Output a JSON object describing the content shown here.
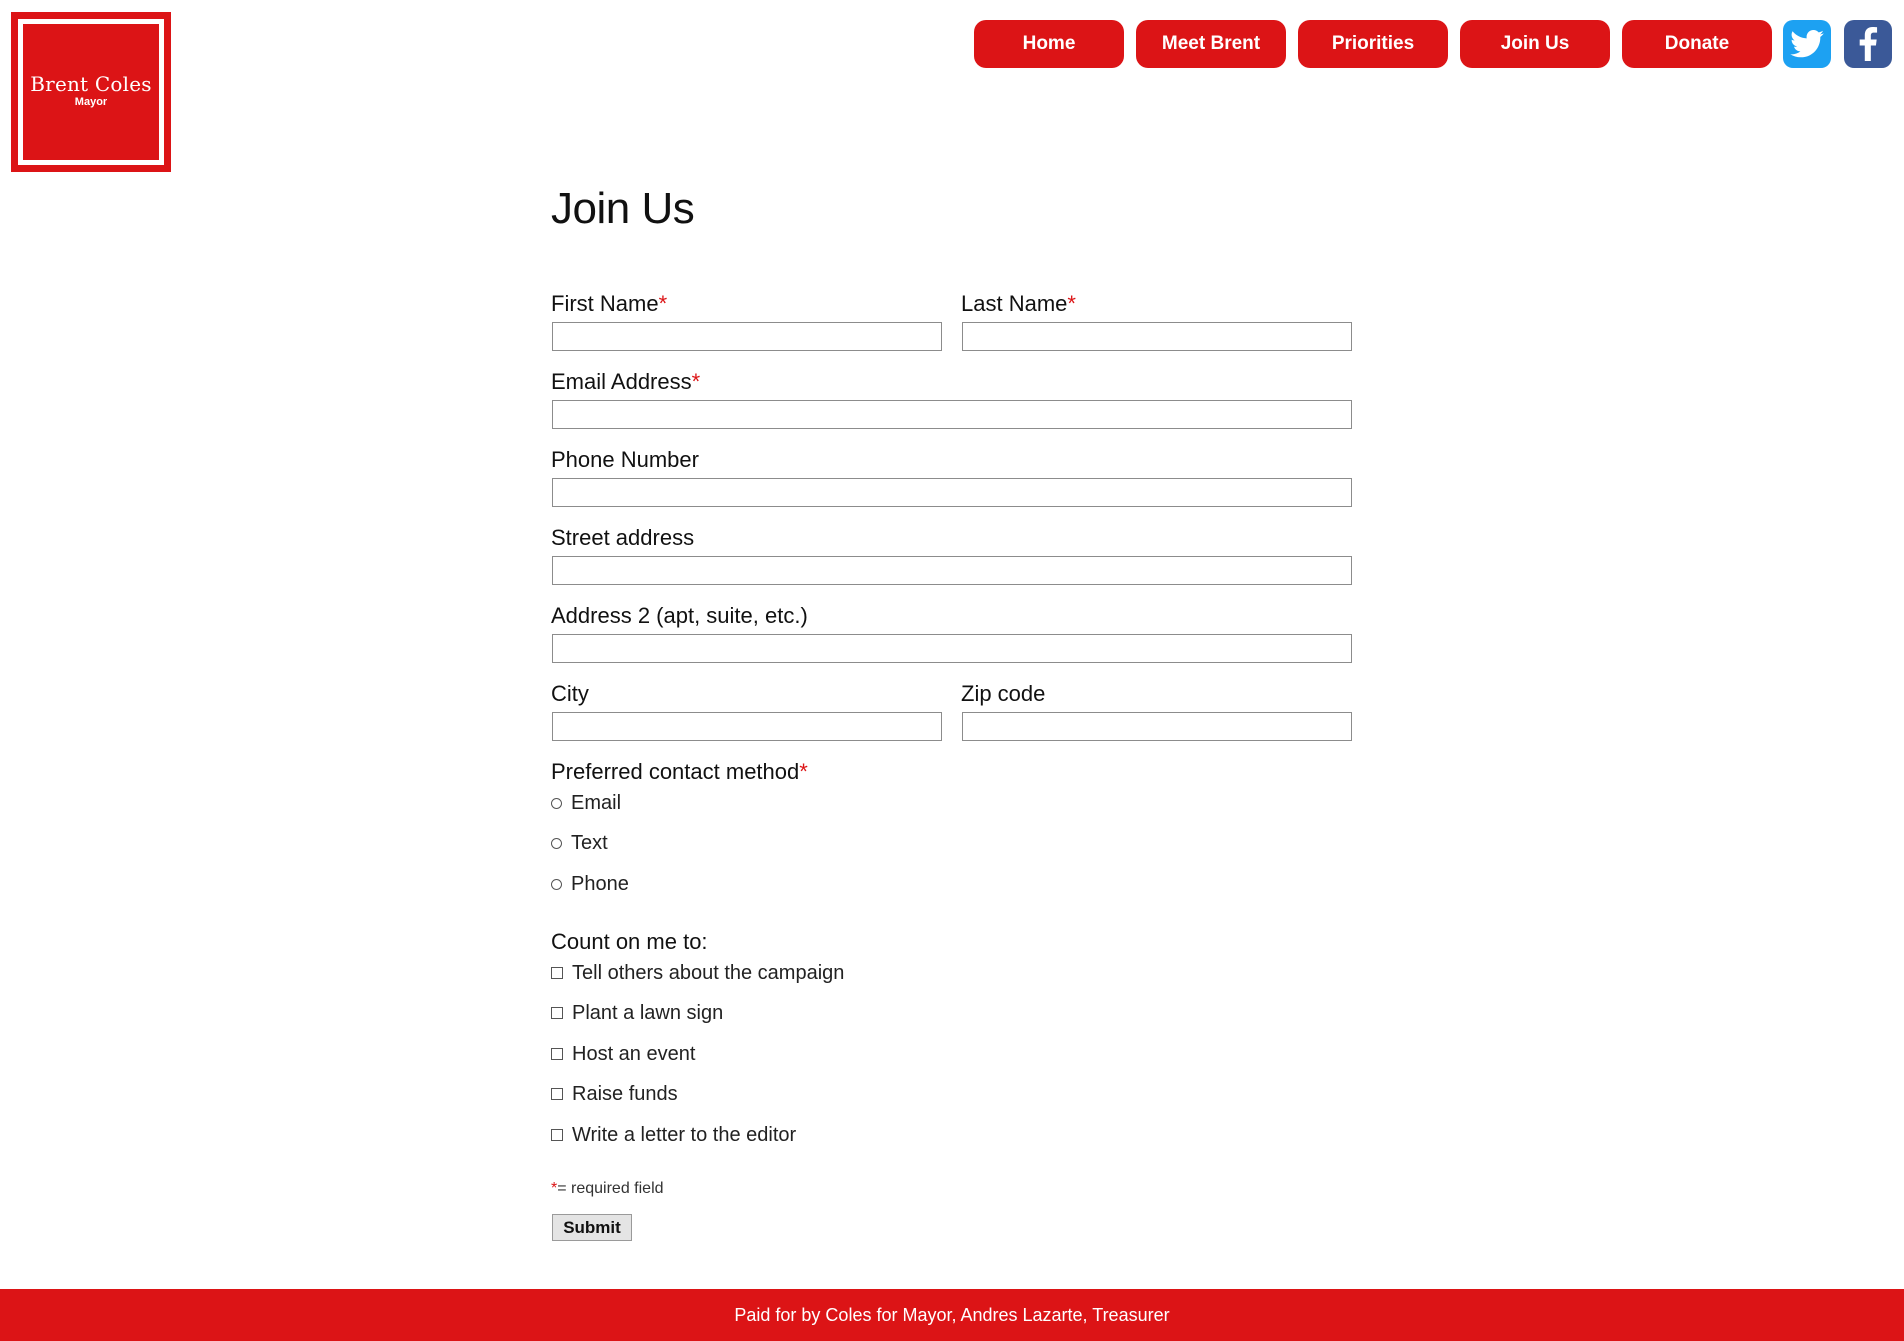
{
  "logo": {
    "name": "Brent Coles",
    "title": "Mayor"
  },
  "nav": {
    "items": [
      "Home",
      "Meet Brent",
      "Priorities",
      "Join Us",
      "Donate"
    ],
    "social": [
      "twitter-icon",
      "facebook-icon"
    ]
  },
  "colors": {
    "brand_red": "#dc1416",
    "twitter": "#1da1f2",
    "facebook": "#3b5998"
  },
  "form": {
    "title": "Join Us",
    "first_name": {
      "label": "First Name",
      "value": ""
    },
    "last_name": {
      "label": "Last Name",
      "value": ""
    },
    "email": {
      "label": "Email Address",
      "value": ""
    },
    "phone": {
      "label": "Phone Number",
      "value": ""
    },
    "street": {
      "label": "Street address",
      "value": ""
    },
    "address2": {
      "label": "Address 2 (apt, suite, etc.)",
      "value": ""
    },
    "city": {
      "label": "City",
      "value": ""
    },
    "zip": {
      "label": "Zip code",
      "value": ""
    },
    "contact_method": {
      "label": "Preferred contact method",
      "options": [
        "Email",
        "Text",
        "Phone"
      ]
    },
    "count_on_me": {
      "label": "Count on me to:",
      "options": [
        "Tell others about the campaign",
        "Plant a lawn sign",
        "Host an event",
        "Raise funds",
        "Write a letter to the editor"
      ]
    },
    "required_mark": "*",
    "required_note": "= required field",
    "submit_label": "Submit"
  },
  "footer": {
    "text": "Paid for by Coles for Mayor, Andres Lazarte, Treasurer"
  }
}
